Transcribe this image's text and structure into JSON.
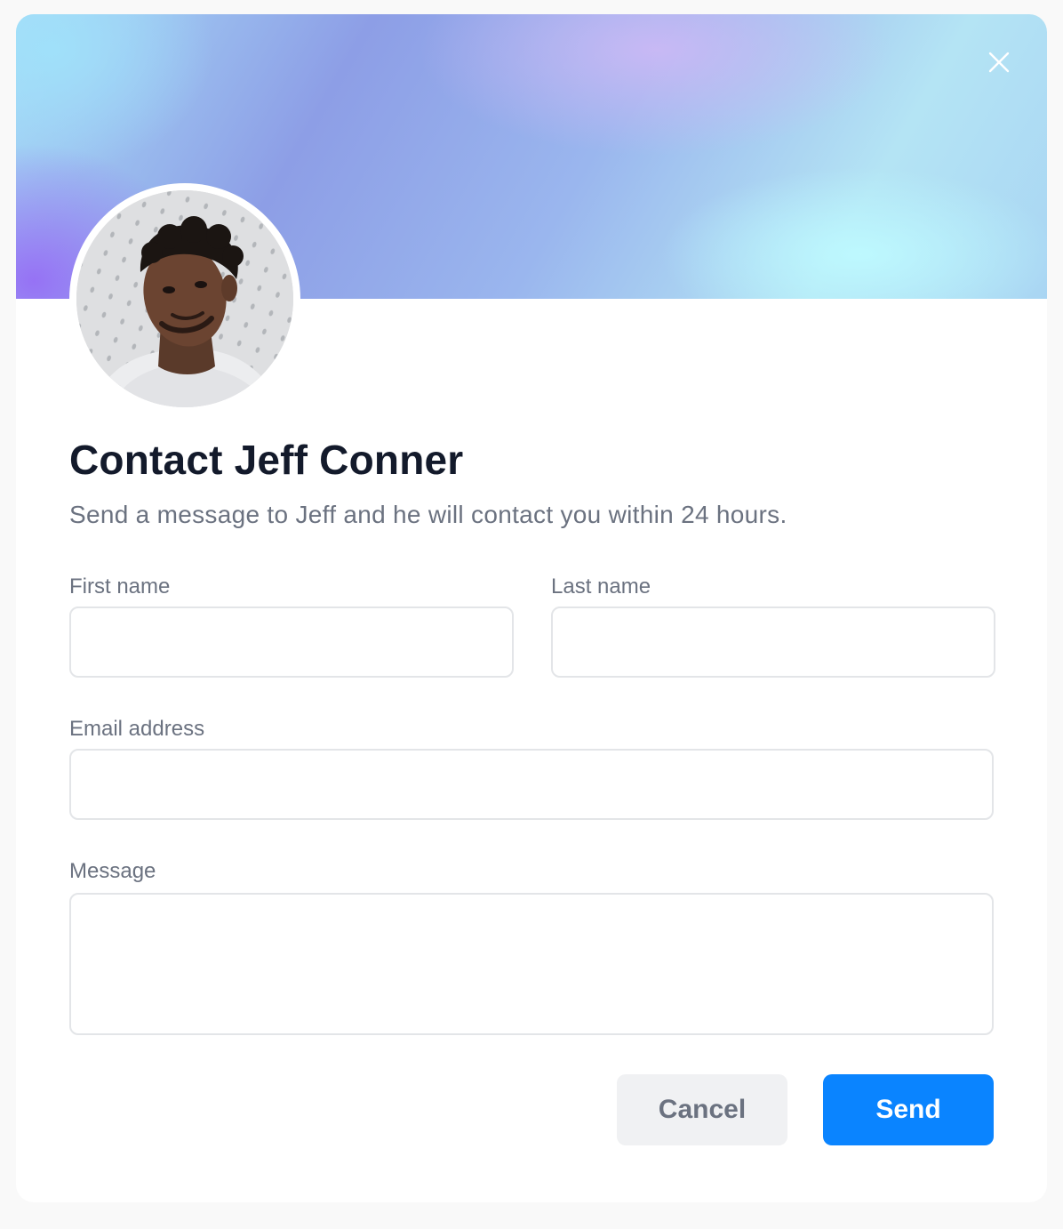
{
  "modal": {
    "title": "Contact Jeff Conner",
    "subtitle": "Send a message to Jeff and he will contact you within 24 hours.",
    "close_icon": "close-icon",
    "avatar_icon": "avatar-photo"
  },
  "form": {
    "first_name": {
      "label": "First name",
      "value": ""
    },
    "last_name": {
      "label": "Last name",
      "value": ""
    },
    "email": {
      "label": "Email address",
      "value": ""
    },
    "message": {
      "label": "Message",
      "value": ""
    }
  },
  "actions": {
    "cancel_label": "Cancel",
    "send_label": "Send"
  },
  "colors": {
    "primary": "#0a84ff",
    "title": "#131a2b",
    "muted": "#6b7280",
    "border": "#e3e5e8",
    "cancel_bg": "#f0f1f3"
  }
}
